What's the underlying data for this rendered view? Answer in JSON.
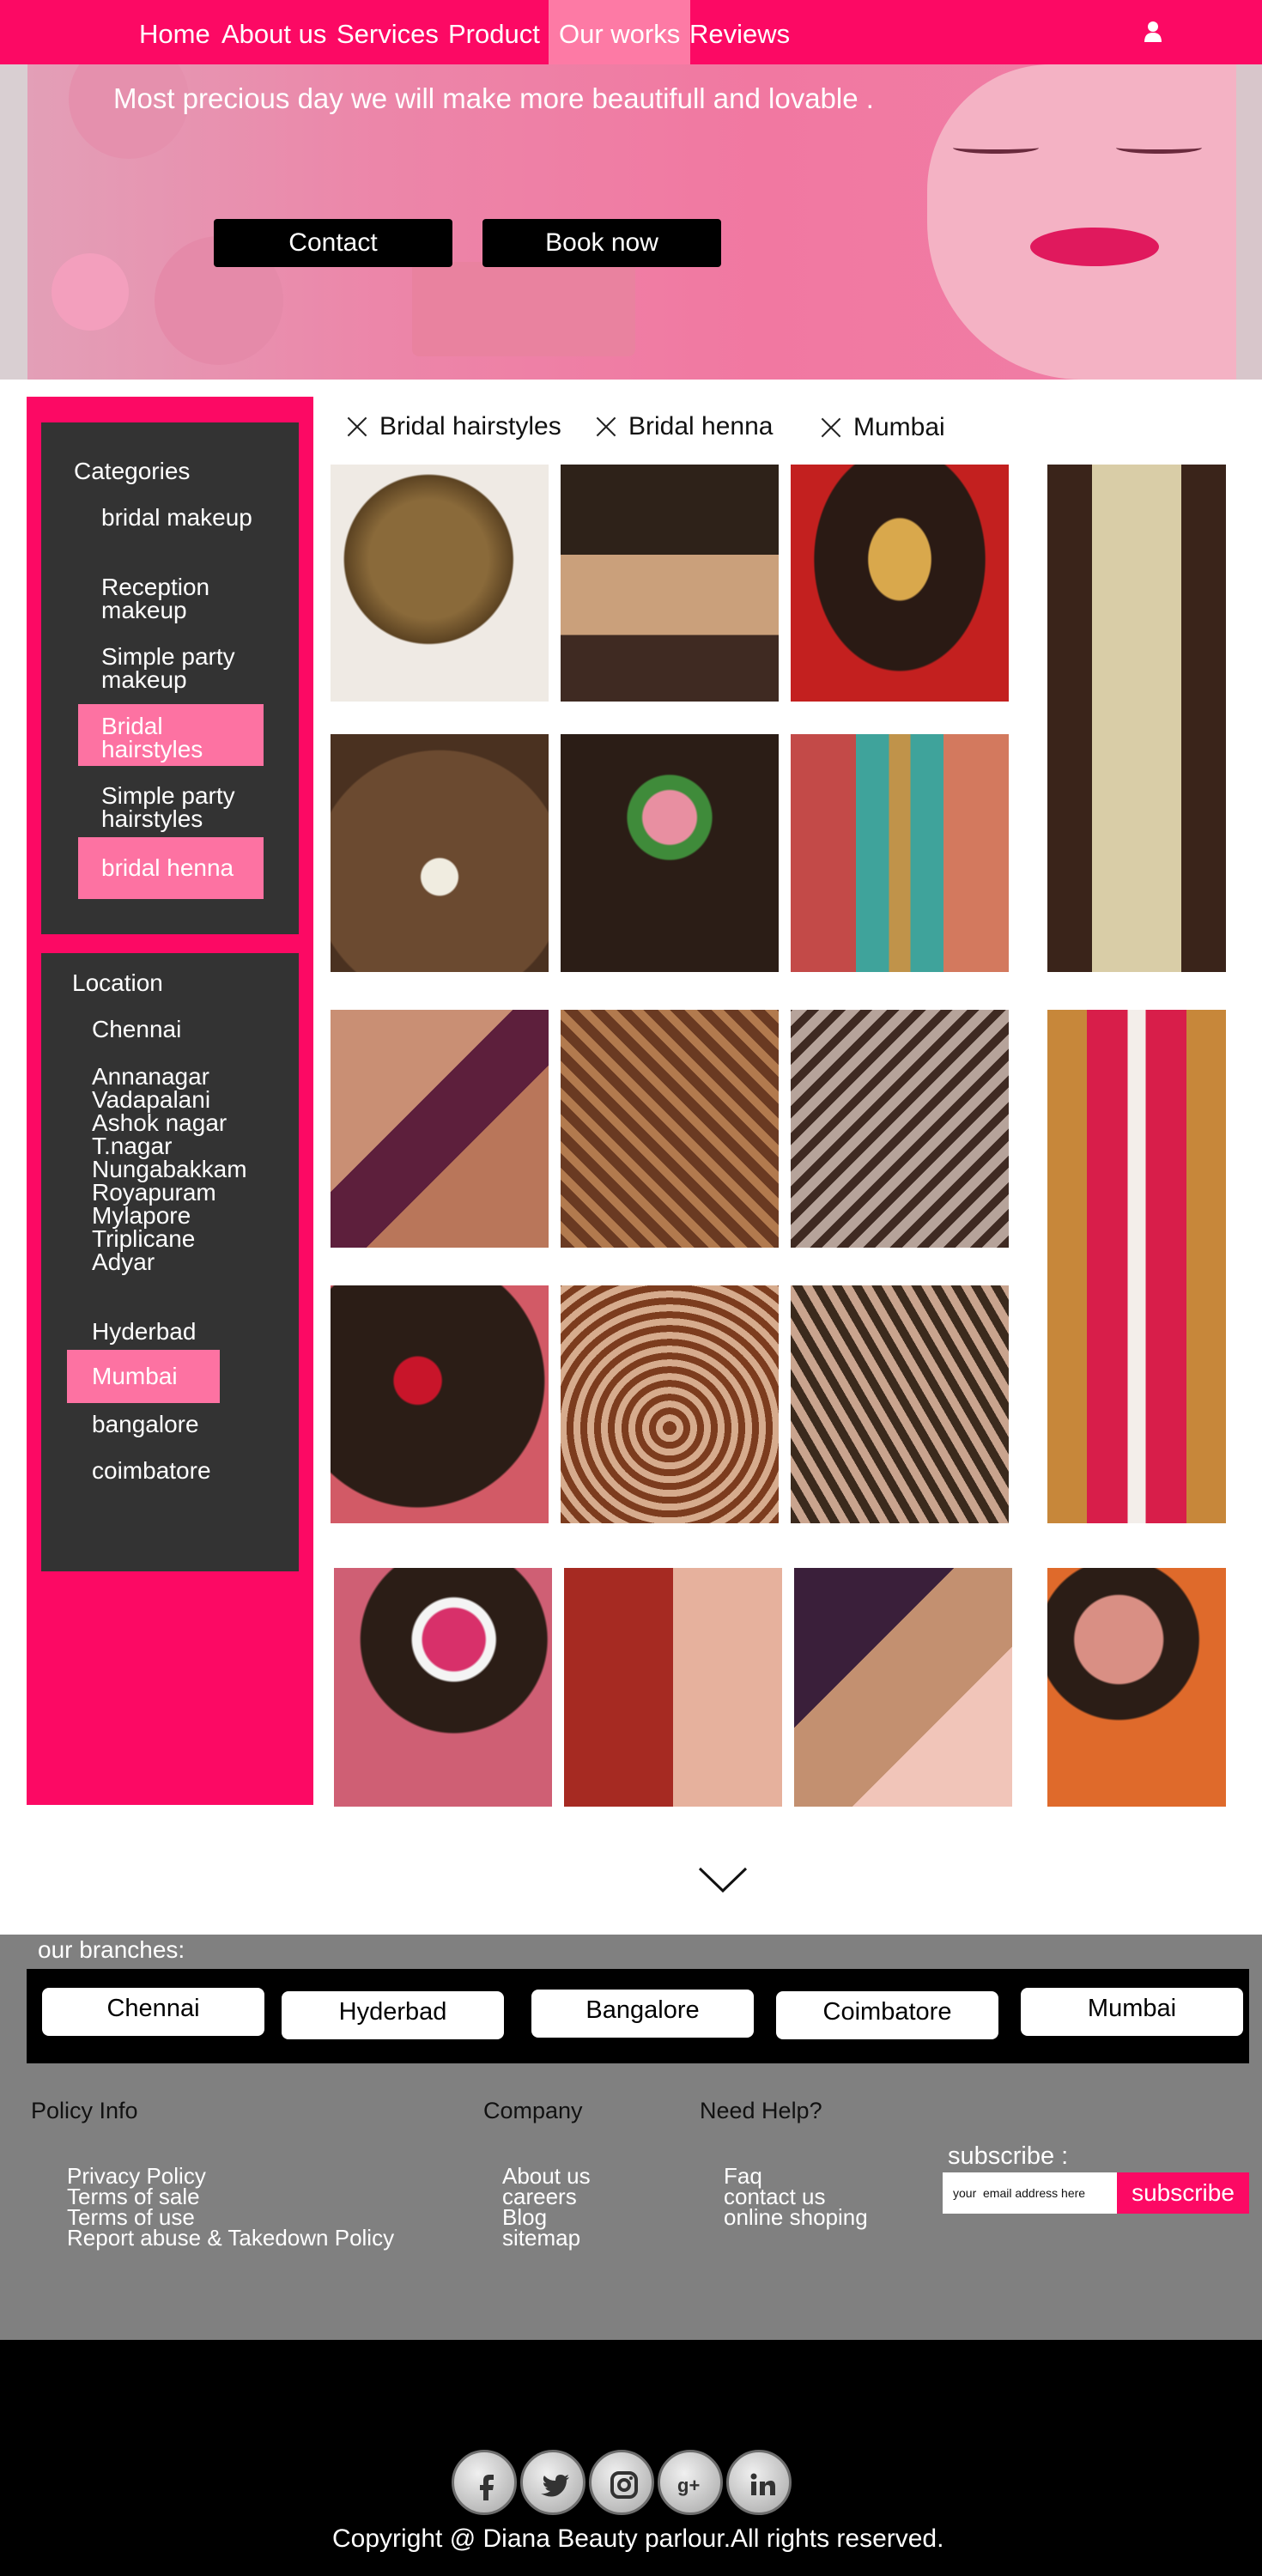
{
  "nav": {
    "items": [
      "Home",
      "About us",
      "Services",
      "Product",
      "Our works",
      "Reviews"
    ],
    "active": "Our works"
  },
  "hero": {
    "tagline": "Most precious day we will  make more  beautifull and lovable .",
    "contact_label": "Contact",
    "book_label": "Book now"
  },
  "categories": {
    "title": "Categories",
    "items": [
      "bridal makeup",
      "Reception makeup",
      "Simple party makeup",
      "Bridal hairstyles",
      "Simple party hairstyles",
      "bridal henna"
    ],
    "selected": [
      "Bridal hairstyles",
      "bridal henna"
    ]
  },
  "location": {
    "title": "Location",
    "chennai": "Chennai",
    "chennai_areas": [
      "Annanagar",
      "Vadapalani",
      "Ashok nagar",
      "T.nagar",
      "Nungabakkam",
      "Royapuram",
      "Mylapore",
      "Triplicane",
      "Adyar"
    ],
    "cities": [
      "Hyderbad",
      "Mumbai",
      "bangalore",
      "coimbatore"
    ],
    "selected": "Mumbai"
  },
  "filters": [
    "Bridal hairstyles",
    "Bridal henna",
    "Mumbai"
  ],
  "gallery": {
    "photos": [
      "hairstyle-curls",
      "hairstyle-maang-tikka",
      "hairstyle-gold-bun",
      "hairstyle-flower-braid-long",
      "hairstyle-pearl-bun",
      "hairstyle-rose-braid",
      "hairstyle-jewel-braid",
      "henna-face",
      "henna-hands",
      "henna-palms",
      "hairstyle-red-flower-braid-long",
      "hairstyle-red-roses",
      "henna-feet",
      "henna-arms",
      "hairstyle-pink-bun",
      "henna-face-closeup",
      "bride-earrings",
      "bride-floral-bun"
    ]
  },
  "more_icon": "chevron-down-icon",
  "branches": {
    "title": "our branches:",
    "items": [
      "Chennai",
      "Hyderbad",
      "Bangalore",
      "Coimbatore",
      "Mumbai"
    ]
  },
  "footer_links": {
    "policy_title": "Policy Info",
    "policy": [
      "Privacy Policy",
      "Terms of sale",
      "Terms of use",
      "Report abuse & Takedown Policy"
    ],
    "company_title": "Company",
    "company": [
      "About us",
      "careers",
      "Blog",
      "sitemap"
    ],
    "help_title": "Need Help?",
    "help": [
      "Faq",
      "contact us",
      "online shoping"
    ]
  },
  "subscribe": {
    "label": "subscribe :",
    "placeholder": "your  email address here",
    "button": "subscribe"
  },
  "social": [
    "facebook-icon",
    "twitter-icon",
    "instagram-icon",
    "google-plus-icon",
    "linkedin-icon"
  ],
  "copyright": "Copyright @ Diana Beauty parlour.All rights reserved.",
  "colors": {
    "brand_pink": "#fc0964",
    "highlight_pink": "#fd72a2",
    "panel_dark": "#333333",
    "footer_gray": "#808080"
  }
}
